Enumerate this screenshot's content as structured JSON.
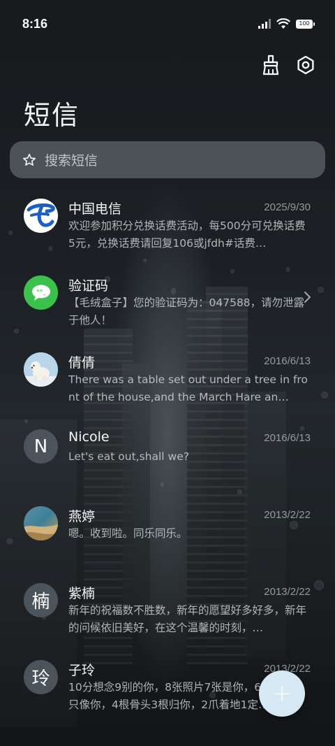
{
  "status_bar": {
    "time": "8:16",
    "battery": "100"
  },
  "header": {
    "title": "短信"
  },
  "search": {
    "placeholder": "搜索短信"
  },
  "conversations": [
    {
      "name": "中国电信",
      "date": "2025/9/30",
      "preview": "欢迎参加积分兑换话费活动，每500分可兑换话费5元，兑换话费请回复106或jfdh#话费…",
      "avatar": "china-telecom-logo"
    },
    {
      "name": "验证码",
      "date": "",
      "preview": "【毛绒盒子】您的验证码为：047588，请勿泄露于他人！",
      "avatar": "message-bubble-icon"
    },
    {
      "name": "倩倩",
      "date": "2016/6/13",
      "preview": "There was a table set out under a tree in front of the house,and the March Hare an…",
      "avatar": "polar-bear-photo"
    },
    {
      "name": "Nicole",
      "date": "2016/6/13",
      "preview": "Let's eat out,shall we?",
      "avatar_letter": "N"
    },
    {
      "name": "燕婷",
      "date": "2013/2/22",
      "preview": "嗯。收到啦。同乐同乐。",
      "avatar": "landscape-photo"
    },
    {
      "name": "紫楠",
      "date": "2013/2/22",
      "preview": "新年的祝福数不胜数，新年的愿望好多好多，新年的问候依旧美好，在这个温馨的时刻，…",
      "avatar_letter": "楠"
    },
    {
      "name": "子玲",
      "date": "2013/2/22",
      "preview": "10分想念9别的你，8张照片7张是你，6只小狗5只像你，4根骨头3根归你，2爪着地1定…",
      "avatar_letter": "玲"
    }
  ],
  "fab": {
    "label": "+"
  },
  "colors": {
    "fab": "#d6e8f4",
    "search_bg": "#5e686e",
    "verify_green": "#3cc24c",
    "telecom_blue": "#1c5fc2"
  }
}
